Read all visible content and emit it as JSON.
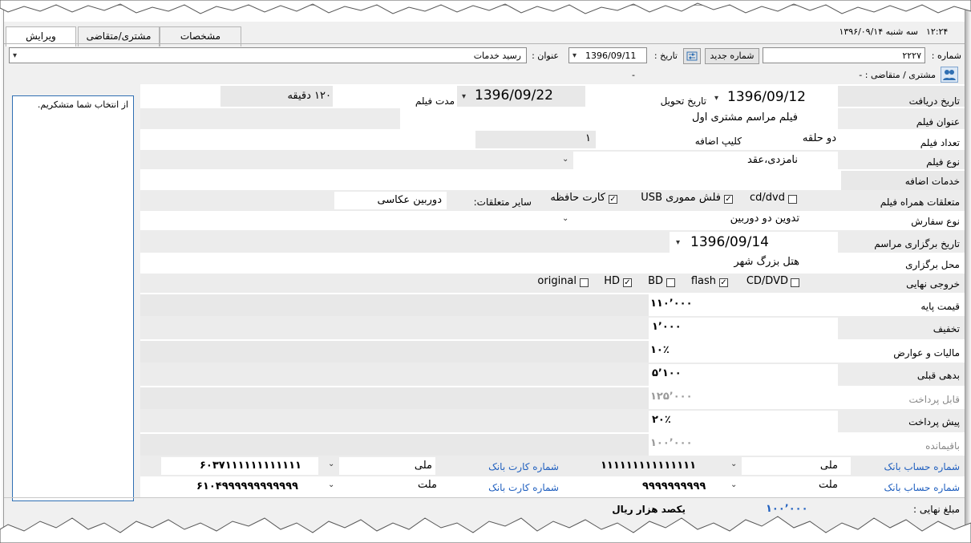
{
  "header": {
    "time": "۱۲:۲۴",
    "date_text": "سه شنبه ۱۳۹۶/۰۹/۱۴"
  },
  "tabs": [
    {
      "label": "ویرایش"
    },
    {
      "label": "مشتری/متقاضی"
    },
    {
      "label": "مشخصات"
    }
  ],
  "toolbar": {
    "number_label": "شماره :",
    "number_value": "۲۲۲۷",
    "new_number_button": "شماره جدید",
    "date_label": "تاریخ :",
    "date_value": "1396/09/11",
    "title_label": "عنوان :",
    "title_value": "رسید خدمات",
    "customer_label": "مشتری / متقاضی : -",
    "dash": "-"
  },
  "note_text": "از انتخاب شما متشکریم.",
  "form": {
    "receive_date_label": "تاریخ دریافت",
    "receive_date": "1396/09/12",
    "delivery_date_label": "تاریخ تحویل",
    "delivery_date": "1396/09/22",
    "duration_label": "مدت فیلم",
    "duration_value": "۱۲۰ دقیقه",
    "film_title_label": "عنوان فیلم",
    "film_title": "فیلم مراسم مشتری اول",
    "film_count_label": "تعداد فیلم",
    "film_count": "دو حلقه",
    "extra_clip_label": "کلیپ اضافه",
    "extra_clip": "۱",
    "film_type_label": "نوع فیلم",
    "film_type": "نامزدی،عقد",
    "extra_services_label": "خدمات اضافه",
    "accessories_label": "متعلقات همراه فیلم",
    "acc_cd": "cd/dvd",
    "acc_usb": "فلش مموری USB",
    "acc_card": "کارت حافظه",
    "other_acc_label": "سایر متعلقات:",
    "other_acc": "دوربین عکاسی",
    "order_type_label": "نوع سفارش",
    "order_type": "تدوین دو دوربین",
    "ceremony_date_label": "تاریخ برگزاری مراسم",
    "ceremony_date": "1396/09/14",
    "venue_label": "محل برگزاری",
    "venue": "هتل بزرگ شهر",
    "output_label": "خروجی نهایی",
    "out_cddvd": "CD/DVD",
    "out_flash": "flash",
    "out_bd": "BD",
    "out_hd": "HD",
    "out_original": "original",
    "base_price_label": "قیمت پایه",
    "base_price": "۱۱۰٬۰۰۰",
    "discount_label": "تخفیف",
    "discount": "۱٬۰۰۰",
    "tax_label": "مالیات و عوارض",
    "tax": "۱۰٪",
    "prev_debt_label": "بدهی قبلی",
    "prev_debt": "۵٬۱۰۰",
    "payable_label": "قابل پرداخت",
    "payable": "۱۲۵٬۰۰۰",
    "prepay_label": "پیش پرداخت",
    "prepay": "۲۰٪",
    "remain_label": "باقیمانده",
    "remain": "۱۰۰٬۰۰۰"
  },
  "bank_rows": [
    {
      "acct_label": "شماره حساب بانک",
      "acct_bank": "ملی",
      "acct_number": "۱۱۱۱۱۱۱۱۱۱۱۱۱۱۱",
      "card_label": "شماره کارت بانک",
      "card_bank": "ملی",
      "card_number": "۶۰۳۷۱۱۱۱۱۱۱۱۱۱۱۱"
    },
    {
      "acct_label": "شماره حساب بانک",
      "acct_bank": "ملت",
      "acct_number": "۹۹۹۹۹۹۹۹۹۹",
      "card_label": "شماره کارت بانک",
      "card_bank": "ملت",
      "card_number": "۶۱۰۴۹۹۹۹۹۹۹۹۹۹۹۹"
    }
  ],
  "final": {
    "label": "مبلغ نهایی :",
    "amount": "۱۰۰٬۰۰۰",
    "in_words": "یکصد  هزار  ریال"
  },
  "colors": {
    "link": "#1f5fbf",
    "accent": "#2f6fb3"
  }
}
